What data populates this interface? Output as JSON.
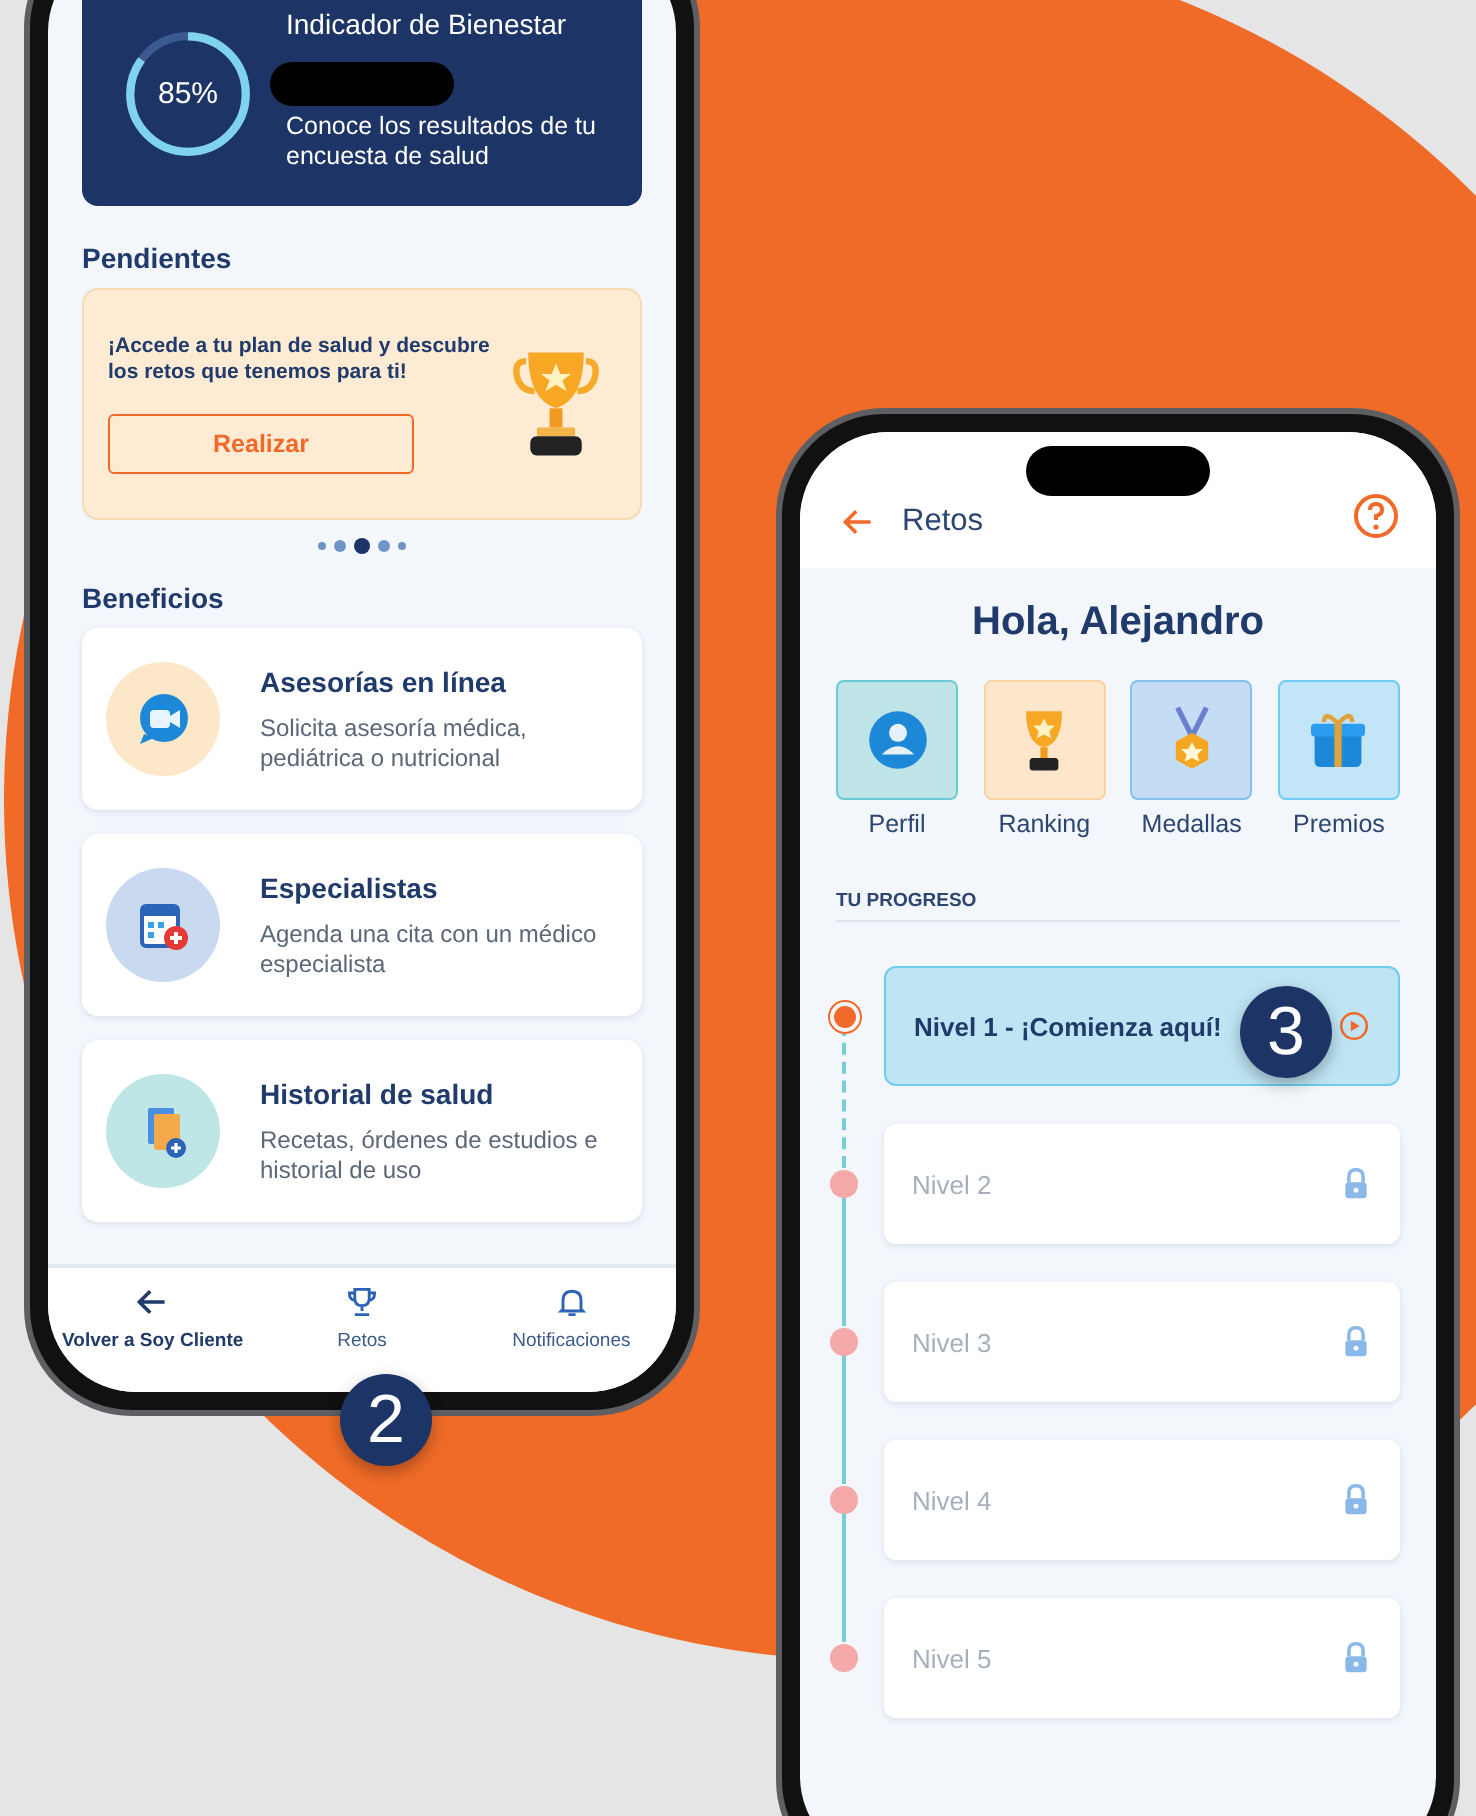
{
  "home_screen": {
    "wellbeing_card": {
      "percent": "85%",
      "level": 0.85,
      "title": "Indicador de Bienestar",
      "subtitle": "Conoce los resultados de tu encuesta de salud"
    },
    "pending": {
      "heading": "Pendientes",
      "message": "¡Accede a tu plan de salud y descubre los retos que tenemos para ti!",
      "button": "Realizar",
      "pager": [
        {
          "selected": false
        },
        {
          "selected": false
        },
        {
          "selected": true
        },
        {
          "selected": false
        },
        {
          "selected": false
        }
      ]
    },
    "benefits": {
      "heading": "Beneficios",
      "items": [
        {
          "kind": "video",
          "title": "Asesorías en línea",
          "description": "Solicita asesoría médica, pediátrica o nutricional"
        },
        {
          "kind": "calendar",
          "title": "Especialistas",
          "description": "Agenda una cita con un médico especialista"
        },
        {
          "kind": "records",
          "title": "Historial de salud",
          "description": "Recetas, órdenes de estudios e historial de uso"
        }
      ]
    },
    "bottom_nav": [
      {
        "kind": "back",
        "label": "Volver a Soy Cliente"
      },
      {
        "kind": "trophy",
        "label": "Retos"
      },
      {
        "kind": "bell",
        "label": "Notificaciones"
      }
    ],
    "step_badge": "2"
  },
  "retos_screen": {
    "title": "Retos",
    "greeting": "Hola, Alejandro",
    "shortcuts": [
      {
        "kind": "profile",
        "label": "Perfil"
      },
      {
        "kind": "ranking",
        "label": "Ranking"
      },
      {
        "kind": "medals",
        "label": "Medallas"
      },
      {
        "kind": "prizes",
        "label": "Premios"
      }
    ],
    "progress_heading": "TU PROGRESO",
    "levels": [
      {
        "label": "Nivel 1 - ¡Comienza aquí!",
        "locked": false
      },
      {
        "label": "Nivel 2",
        "locked": true
      },
      {
        "label": "Nivel 3",
        "locked": true
      },
      {
        "label": "Nivel 4",
        "locked": true
      },
      {
        "label": "Nivel 5",
        "locked": true
      }
    ],
    "step_badge": "3"
  }
}
